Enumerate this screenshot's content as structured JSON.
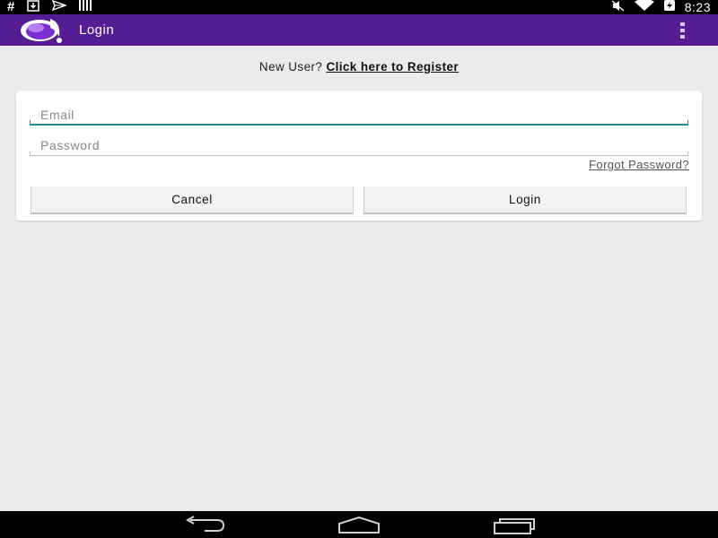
{
  "status_bar": {
    "time": "8:23",
    "left_icons": [
      "hash-icon",
      "download-icon",
      "send-icon",
      "signal-bars-icon"
    ],
    "right_icons": [
      "mute-icon",
      "wifi-icon",
      "battery-charging-icon"
    ]
  },
  "action_bar": {
    "title": "Login",
    "logo": "app-logo-icon",
    "menu": "overflow-menu-icon",
    "color": "#551c94"
  },
  "register": {
    "prompt": "New User?",
    "link": "Click here to Register"
  },
  "form": {
    "email_placeholder": "Email",
    "email_value": "",
    "password_placeholder": "Password",
    "password_value": "",
    "forgot_label": "Forgot Password?",
    "cancel_label": "Cancel",
    "login_label": "Login",
    "focus_color": "#2a8a94"
  },
  "nav_bar": {
    "buttons": [
      "back-icon",
      "home-icon",
      "recents-icon"
    ]
  }
}
